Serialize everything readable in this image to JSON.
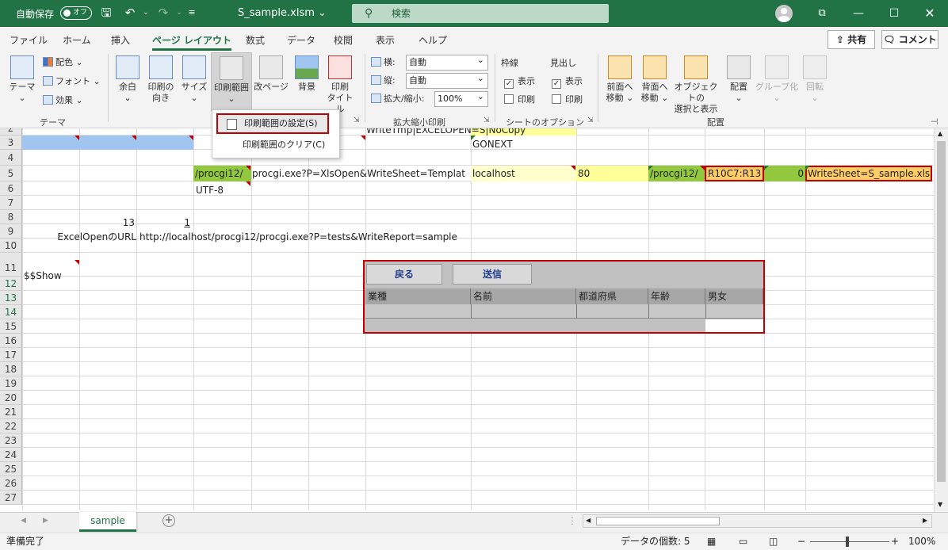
{
  "titlebar": {
    "autosave_label": "自動保存",
    "autosave_state": "オフ",
    "filename": "S_sample.xlsm ⌄",
    "search_placeholder": "検索",
    "icons": [
      "save-icon",
      "undo-icon",
      "redo-icon",
      "customize-icon",
      "user-avatar",
      "ribbon-display-icon",
      "minimize-icon",
      "maximize-icon",
      "close-icon"
    ]
  },
  "tabs": [
    "ファイル",
    "ホーム",
    "挿入",
    "ページ レイアウト",
    "数式",
    "データ",
    "校閲",
    "表示",
    "ヘルプ"
  ],
  "active_tab": "ページ レイアウト",
  "share_label": "共有",
  "comment_label": "コメント",
  "ribbon": {
    "theme": {
      "themes": "テーマ",
      "colors": "配色 ⌄",
      "fonts": "フォント ⌄",
      "effects": "効果 ⌄",
      "group": "テーマ"
    },
    "page_setup": {
      "margins": "余白",
      "orientation": "印刷の\n向き",
      "size": "サイズ",
      "print_area": "印刷範囲",
      "breaks": "改ページ",
      "background": "背景",
      "print_titles": "印刷\nタイトル"
    },
    "scale": {
      "width_label": "横:",
      "width_value": "自動",
      "height_label": "縦:",
      "height_value": "自動",
      "scale_label": "拡大/縮小:",
      "scale_value": "100%",
      "group": "拡大縮小印刷"
    },
    "sheet_options": {
      "gridlines": "枠線",
      "headings": "見出し",
      "view": "表示",
      "print": "印刷",
      "group": "シートのオプション",
      "gridlines_view": true,
      "gridlines_print": false,
      "headings_view": true,
      "headings_print": false
    },
    "arrange": {
      "bring_forward": "前面へ\n移動 ⌄",
      "send_backward": "背面へ\n移動 ⌄",
      "selection_pane": "オブジェクトの\n選択と表示",
      "align": "配置",
      "group_btn": "グループ化",
      "rotate": "回転",
      "group": "配置"
    }
  },
  "dropdown": {
    "set_print_area": "印刷範囲の設定(S)",
    "clear_print_area": "印刷範囲のクリア(C)"
  },
  "rows": [
    "2",
    "3",
    "4",
    "5",
    "6",
    "7",
    "8",
    "9",
    "10",
    "11",
    "12",
    "13",
    "14",
    "15",
    "16",
    "17",
    "18",
    "19",
    "20",
    "21",
    "22",
    "23",
    "24",
    "25",
    "26",
    "27"
  ],
  "cells": {
    "r2_top": "WriteTmp|EXCELOPEN=S|NoCopy",
    "r3_gonext": "GONEXT",
    "r5_a": "/procgi12/",
    "r5_b": "procgi.exe?P=XlsOpen&WriteSheet=Templat",
    "r5_c": "localhost",
    "r5_d": "80",
    "r5_e": "/procgi12/",
    "r5_f": "R10C7:R13",
    "r5_g": "0",
    "r5_h": "WriteSheet=S_sample.xls",
    "r6": "UTF-8",
    "r8_b": "13",
    "r8_c": "1",
    "r9_label": "ExcelOpenのURL",
    "r9_url": "http://localhost/procgi12/procgi.exe?P=tests&WriteReport=sample",
    "r11": "$$Show"
  },
  "form": {
    "back": "戻る",
    "send": "送信",
    "headers": [
      "業種",
      "名前",
      "都道府県",
      "年齢",
      "男女"
    ]
  },
  "sheet_tab": "sample",
  "status": {
    "ready": "準備完了",
    "count": "データの個数: 5",
    "zoom": "100%"
  }
}
